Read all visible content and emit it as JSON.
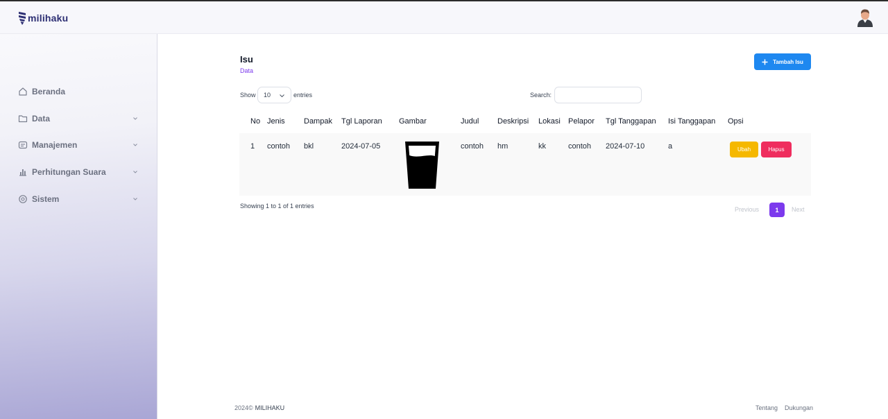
{
  "brand": {
    "name": "milihaku"
  },
  "colors": {
    "primary": "#7c3aed",
    "add_button": "#1e88f0",
    "edit_button": "#f5b800",
    "delete_button": "#ef2d5e",
    "brand_text": "#2d2f73"
  },
  "sidebar": {
    "items": [
      {
        "label": "Beranda",
        "icon": "home-icon",
        "has_submenu": false
      },
      {
        "label": "Data",
        "icon": "folder-icon",
        "has_submenu": true
      },
      {
        "label": "Manajemen",
        "icon": "id-card-icon",
        "has_submenu": true
      },
      {
        "label": "Perhitungan Suara",
        "icon": "bar-chart-icon",
        "has_submenu": true
      },
      {
        "label": "Sistem",
        "icon": "settings-icon",
        "has_submenu": true
      }
    ]
  },
  "page": {
    "title": "Isu",
    "subtitle": "Data",
    "add_button": "Tambah Isu"
  },
  "controls": {
    "show_label": "Show",
    "length_value": "10",
    "entries_label": "entries",
    "search_label": "Search:",
    "search_value": ""
  },
  "table": {
    "headers": [
      "No",
      "Jenis",
      "Dampak",
      "Tgl Laporan",
      "Gambar",
      "Judul",
      "Deskripsi",
      "Lokasi",
      "Pelapor",
      "Tgl Tanggapan",
      "Isi Tanggapan",
      "Opsi"
    ],
    "rows": [
      {
        "no": "1",
        "jenis": "contoh",
        "dampak": "bkl",
        "tgl_laporan": "2024-07-05",
        "gambar": "glass-icon",
        "judul": "contoh",
        "deskripsi": "hm",
        "lokasi": "kk",
        "pelapor": "contoh",
        "tgl_tanggapan": "2024-07-10",
        "isi_tanggapan": "a",
        "edit_label": "Ubah",
        "delete_label": "Hapus"
      }
    ]
  },
  "pagination": {
    "info": "Showing 1 to 1 of 1 entries",
    "previous": "Previous",
    "current": "1",
    "next": "Next"
  },
  "footer": {
    "copyright": "2024©",
    "brand": "MILIHAKU",
    "links": [
      "Tentang",
      "Dukungan"
    ]
  }
}
